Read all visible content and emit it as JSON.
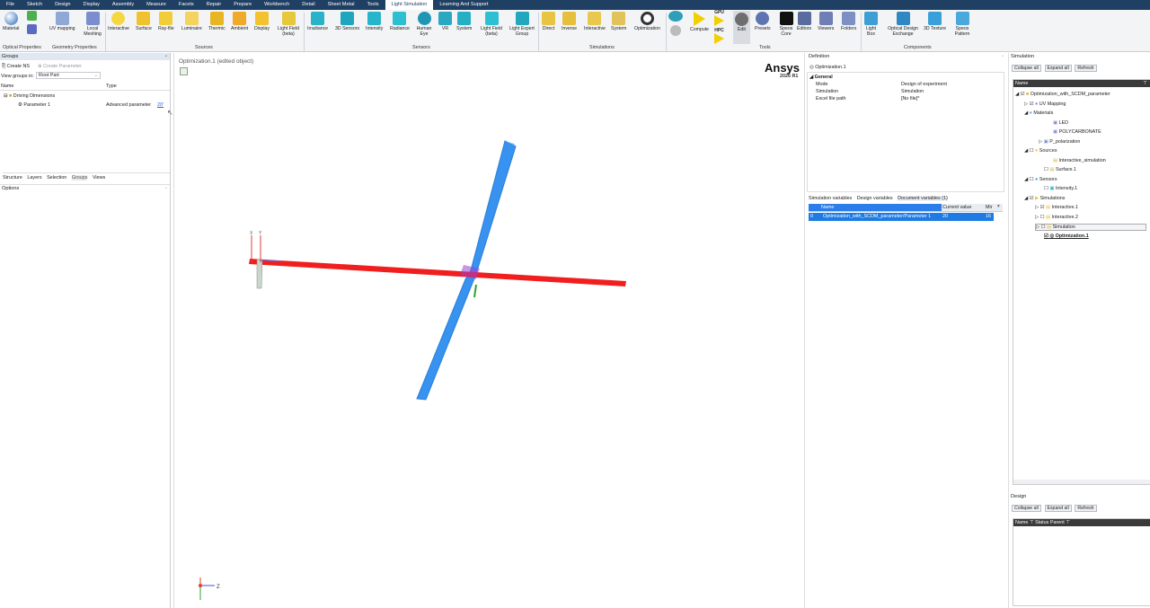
{
  "menu": [
    "File",
    "Sketch",
    "Design",
    "Display",
    "Assembly",
    "Measure",
    "Facets",
    "Repair",
    "Prepare",
    "Workbench",
    "Detail",
    "Sheet Metal",
    "Tools",
    "Light Simulation",
    "Learning And Support"
  ],
  "menu_active_index": 13,
  "ribbon": {
    "buttons": [
      "Material",
      "UV mapping",
      "Local Meshing",
      "Interactive",
      "Surface",
      "Ray-file",
      "Luminaire",
      "Thermic",
      "Ambient",
      "Display",
      "Light Field (beta)",
      "Irradiance",
      "3D Sensors",
      "Intensity",
      "Radiance",
      "Human Eye",
      "VR",
      "System",
      "Light Field (beta)",
      "Light Expert Group",
      "Direct",
      "Inverse",
      "Interactive",
      "System",
      "Optimization",
      "Compute",
      "Edit",
      "Presets",
      "Speos Core",
      "Editors",
      "Viewers",
      "Folders",
      "Light Box",
      "Optical Design Exchange",
      "3D Texture",
      "Speos Pattern"
    ],
    "small_labels": {
      "gpu": "GPU",
      "hpc": "HPC"
    },
    "groups": [
      "Optical Properties",
      "Geometry Properties",
      "Sources",
      "Sensors",
      "Simulations",
      "Tools",
      "Components"
    ]
  },
  "left": {
    "groups_title": "Groups",
    "create_ns": "Create NS",
    "create_parameter": "Create Parameter",
    "view_groups_label": "View groups in:",
    "view_groups_value": "Root Part",
    "col_name": "Name",
    "col_type": "Type",
    "tree_driving": "Driving Dimensions",
    "tree_param": "Parameter 1",
    "tree_param_type": "Advanced parameter",
    "tree_param_value": "20'",
    "tabs": [
      "Structure",
      "Layers",
      "Selection",
      "Groups",
      "Views"
    ],
    "options_title": "Options"
  },
  "viewport": {
    "label": "Optimization.1 (edited object)",
    "brand": "Ansys",
    "version": "2026 R1",
    "axis_x": "X",
    "axis_y": "Y",
    "axis_z": "Z"
  },
  "definition": {
    "title": "Definition",
    "item": "Optimization.1",
    "section": "General",
    "props": [
      {
        "k": "Mode",
        "v": "Design of experiment"
      },
      {
        "k": "Simulation",
        "v": "Simulation"
      },
      {
        "k": "Excel file path",
        "v": "[No file]*"
      }
    ],
    "tabs": [
      "Simulation variables",
      "Design variables",
      "Document variables (1)"
    ],
    "table_cols": [
      "Name",
      "Current value",
      "Mir"
    ],
    "table_row": {
      "idx": "0",
      "name": "Optimization_with_SCDM_parameter/Parameter 1",
      "value": "20",
      "min": "16"
    }
  },
  "simulation": {
    "title": "Simulation",
    "collapse": "Collapse all",
    "expand": "Expand all",
    "refresh": "Refresh",
    "col_name": "Name",
    "tree": [
      "Optimization_with_SCDM_parameter",
      "UV Mapping",
      "Materials",
      "LED",
      "POLYCARBONATE",
      "P_polarization",
      "Sources",
      "Interactive_simulation",
      "Surface.1",
      "Sensors",
      "Intensity.1",
      "Simulations",
      "Interactive.1",
      "Interactive.2",
      "Simulation",
      "Optimization.1"
    ],
    "design_title": "Design",
    "design_cols": [
      "Name",
      "Status",
      "Parent"
    ]
  }
}
